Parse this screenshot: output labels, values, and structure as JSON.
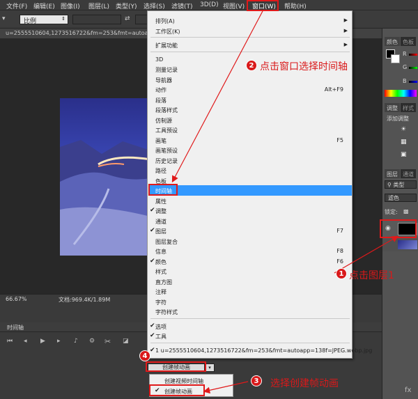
{
  "menubar": {
    "items": [
      "文件(F)",
      "编辑(E)",
      "图像(I)",
      "图层(L)",
      "类型(Y)",
      "选择(S)",
      "滤镜(T)",
      "3D(D)",
      "视图(V)",
      "窗口(W)",
      "帮助(H)"
    ]
  },
  "options": {
    "ratio_label": "比例"
  },
  "document": {
    "tab_title": "u=2555510604,1273516722&fm=253&fmt=autoa",
    "zoom": "66.67%",
    "doc_size": "文档:969.4K/1.89M"
  },
  "timeline": {
    "tab_label": "时间轴",
    "create_button": "创建帧动画"
  },
  "popup": {
    "video_item": "创建视频时间轴",
    "frame_item": "创建帧动画"
  },
  "panels": {
    "color_tab": "颜色",
    "swatches_tab": "色板",
    "rgb": [
      "R",
      "G",
      "B"
    ],
    "adjust_tab": "调整",
    "styles_tab": "样式",
    "add_adjust": "添加调整",
    "layers_tab": "图层",
    "channels_tab": "通道",
    "kind_filter": "类型",
    "blend_mode": "滤色",
    "lock_label": "锁定:"
  },
  "menu": {
    "items": [
      {
        "label": "排列(A)",
        "submenu": true
      },
      {
        "label": "工作区(K)",
        "submenu": true
      },
      {
        "label": "扩展功能",
        "submenu": true
      },
      {
        "label": "3D"
      },
      {
        "label": "测量记录"
      },
      {
        "label": "导航器"
      },
      {
        "label": "动作",
        "shortcut": "Alt+F9"
      },
      {
        "label": "段落"
      },
      {
        "label": "段落样式"
      },
      {
        "label": "仿制源"
      },
      {
        "label": "工具预设"
      },
      {
        "label": "画笔",
        "shortcut": "F5"
      },
      {
        "label": "画笔预设"
      },
      {
        "label": "历史记录"
      },
      {
        "label": "路径"
      },
      {
        "label": "色板"
      },
      {
        "label": "时间轴",
        "highlighted": true
      },
      {
        "label": "属性"
      },
      {
        "label": "调整",
        "checked": true
      },
      {
        "label": "通道"
      },
      {
        "label": "图层",
        "shortcut": "F7",
        "checked": true
      },
      {
        "label": "图层复合"
      },
      {
        "label": "信息",
        "shortcut": "F8"
      },
      {
        "label": "颜色",
        "shortcut": "F6",
        "checked": true
      },
      {
        "label": "样式"
      },
      {
        "label": "直方图"
      },
      {
        "label": "注释"
      },
      {
        "label": "字符"
      },
      {
        "label": "字符样式"
      },
      {
        "label": "选项",
        "checked": true
      },
      {
        "label": "工具",
        "checked": true
      },
      {
        "label": "1 u=2555510604,1273516722&fm=253&fmt=autoapp=138f=JPEG.webp.jpg",
        "checked": true
      }
    ]
  },
  "annotations": {
    "step1_num": "1",
    "step1_text": "点击图层1",
    "step2_num": "2",
    "step2_text": "点击窗口选择时间轴",
    "step3_num": "3",
    "step3_text": "选择创建帧动画",
    "step4_num": "4"
  },
  "colors": {
    "accent": "#e0191a",
    "highlight": "#3399ff"
  }
}
